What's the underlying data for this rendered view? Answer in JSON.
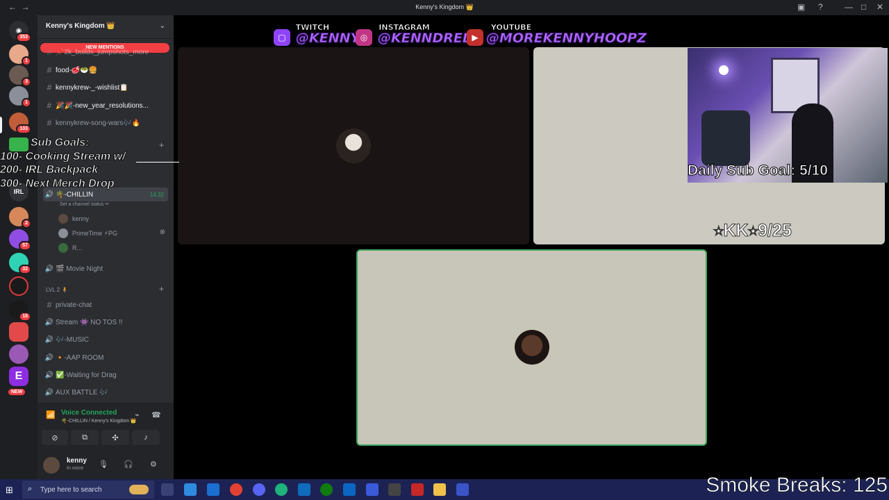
{
  "window": {
    "title": "Kenny's Kingdom 👑"
  },
  "rail": {
    "badges": [
      "353",
      "1",
      "3",
      "1",
      "103",
      "2",
      "57",
      "32",
      "18"
    ],
    "new_label": "NEW",
    "servers": [
      {
        "label": "",
        "color": "#2b2d31"
      },
      {
        "label": "",
        "color": "#e8a88a"
      },
      {
        "label": "",
        "color": "#6b5a52"
      },
      {
        "label": "",
        "color": "#c9574c"
      },
      {
        "label": "",
        "color": "#8a8f99"
      },
      {
        "label": "",
        "color": "#c25d3a"
      },
      {
        "label": "IRL",
        "color": "#313338"
      },
      {
        "label": "",
        "color": "#d7885a"
      },
      {
        "label": "",
        "color": "#8f4de3"
      },
      {
        "label": "",
        "color": "#2fd3b4"
      },
      {
        "label": "",
        "color": "#e03a3a"
      },
      {
        "label": "",
        "color": "#1a1a1a"
      },
      {
        "label": "",
        "color": "#e24a4a"
      },
      {
        "label": "",
        "color": "#9b59b6"
      },
      {
        "label": "E",
        "color": "#8e2de2"
      }
    ]
  },
  "sidebar": {
    "guild_name": "Kenny's Kingdom 👑",
    "new_mentions": "NEW MENTIONS",
    "channels": [
      {
        "name": "📌2k_builds_jumpshots_more",
        "type": "text"
      },
      {
        "name": "food-🥩🥗🍔",
        "type": "text"
      },
      {
        "name": "kennykrew-_-wishlist📋",
        "type": "text"
      },
      {
        "name": "🎉🎉-new_year_resolutions...",
        "type": "text"
      },
      {
        "name": "kennykrew-song-wars🎶🔥",
        "type": "text"
      }
    ],
    "voice_active": {
      "name": "🌴-CHILLIN",
      "time": "14:32",
      "status": "Set a channel status ✏"
    },
    "voice_members": [
      {
        "name": "kenny",
        "color": "#5d4a3e"
      },
      {
        "name": "PrimeTime ⚡PG",
        "color": "#8a8f99"
      },
      {
        "name": "R...",
        "color": "#3a6a3a"
      }
    ],
    "movie_night": "🎬 Movie Night",
    "category": "LVL 2 🧍",
    "channels2": [
      {
        "name": "private-chat",
        "type": "text"
      },
      {
        "name": "Stream 👾 NO TOS !!",
        "type": "voice"
      },
      {
        "name": "🎶-MUSIC",
        "type": "voice"
      },
      {
        "name": "🔸-AAP ROOM",
        "type": "voice"
      },
      {
        "name": "✅-Waiting for Drag",
        "type": "voice"
      },
      {
        "name": "AUX BATTLE 🎶",
        "type": "voice"
      }
    ]
  },
  "voice_panel": {
    "title": "Voice Connected",
    "sub": "🌴-CHILLIN / Kenny's Kingdom 👑"
  },
  "user_panel": {
    "name": "kenny",
    "status": "In voice"
  },
  "overlay": {
    "twitch_label": "TWITCH",
    "twitch_handle": "@KENNY",
    "instagram_label": "INSTAGRAM",
    "instagram_handle": "@KENNDRELL",
    "youtube_label": "YOUTUBE",
    "youtube_handle": "@MOREKENNYHOOPZ",
    "sub_goals_title": "Sub Goals:",
    "sub_goals": [
      "100- Cooking Stream w/",
      "200- IRL Backpack",
      "300- Next Merch Drop"
    ],
    "daily_goal": "Daily Sub Goal: 5/10",
    "kk_date": "⭑KK⭑9/25",
    "smoke_breaks": "Smoke Breaks: 125"
  },
  "taskbar": {
    "search_placeholder": "Type here to search"
  }
}
